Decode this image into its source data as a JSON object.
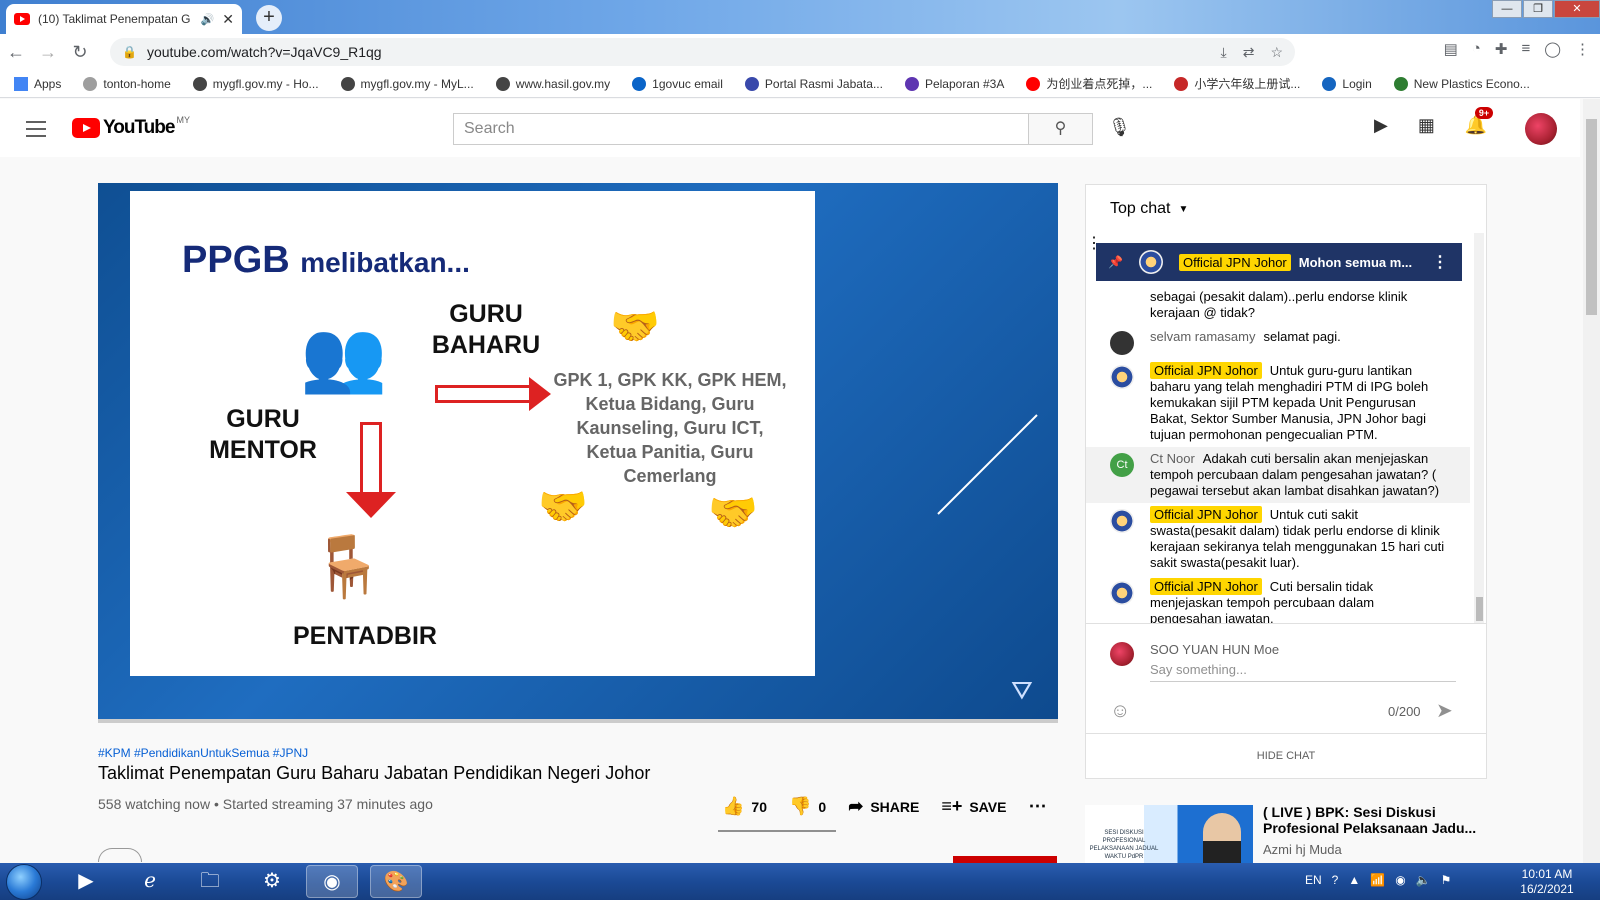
{
  "browser": {
    "tab_title": "(10) Taklimat Penempatan G",
    "url": "youtube.com/watch?v=JqaVC9_R1qg",
    "window_controls": {
      "minimize": "—",
      "maximize": "❐",
      "close": "✕"
    },
    "bookmarks": [
      {
        "label": "Apps",
        "color": "#4285f4"
      },
      {
        "label": "tonton-home",
        "color": "#9e9e9e"
      },
      {
        "label": "mygfl.gov.my - Ho...",
        "color": "#444444"
      },
      {
        "label": "mygfl.gov.my - MyL...",
        "color": "#444444"
      },
      {
        "label": "www.hasil.gov.my",
        "color": "#444444"
      },
      {
        "label": "1govuc email",
        "color": "#0a64c8"
      },
      {
        "label": "Portal Rasmi Jabata...",
        "color": "#3949ab"
      },
      {
        "label": "Pelaporan #3A",
        "color": "#5e35b1"
      },
      {
        "label": "为创业着点死掉，...",
        "color": "#ff0000"
      },
      {
        "label": "小学六年级上册试...",
        "color": "#c62828"
      },
      {
        "label": "Login",
        "color": "#1565c0"
      },
      {
        "label": "New Plastics Econo...",
        "color": "#2e7d32"
      }
    ]
  },
  "youtube": {
    "logo_text": "YouTube",
    "country": "MY",
    "search_placeholder": "Search",
    "notification_count": "9+"
  },
  "slide": {
    "title_main": "PPGB",
    "title_rest": "melibatkan...",
    "label_guru_baharu": "GURU BAHARU",
    "label_guru_mentor": "GURU MENTOR",
    "label_pentadbir": "PENTADBIR",
    "list_text": "GPK 1, GPK KK, GPK HEM, Ketua Bidang, Guru Kaunseling, Guru ICT, Ketua Panitia, Guru Cemerlang"
  },
  "video": {
    "hashtags": "#KPM #PendidikanUntukSemua #JPNJ",
    "title": "Taklimat Penempatan Guru Baharu Jabatan Pendidikan Negeri Johor",
    "stats": "558 watching now • Started streaming 37 minutes ago",
    "likes": "70",
    "dislikes": "0",
    "share_label": "SHARE",
    "save_label": "SAVE",
    "channel_name": "Official JPN Johor"
  },
  "chat": {
    "header": "Top chat",
    "pinned": {
      "author": "Official JPN Johor",
      "text": "Mohon semua m..."
    },
    "messages": [
      {
        "author": "",
        "text": "sebagai (pesakit dalam)..perlu endorse klinik kerajaan @ tidak?",
        "owner": false,
        "highlight": false,
        "avatar": "none"
      },
      {
        "author": "selvam ramasamy",
        "text": "selamat pagi.",
        "owner": false,
        "highlight": false,
        "avatar": "#333333"
      },
      {
        "author": "Official JPN Johor",
        "text": "Untuk guru-guru lantikan baharu yang telah menghadiri PTM di IPG boleh kemukakan sijil PTM kepada Unit Pengurusan Bakat, Sektor Sumber Manusia, JPN Johor bagi tujuan permohonan pengecualian PTM.",
        "owner": true,
        "highlight": false,
        "avatar": "crest"
      },
      {
        "author": "Ct Noor",
        "text": "Adakah cuti bersalin akan menjejaskan tempoh percubaan dalam pengesahan jawatan? ( pegawai tersebut akan lambat disahkan jawatan?)",
        "owner": false,
        "highlight": true,
        "avatar": "#43a047",
        "initials": "Ct"
      },
      {
        "author": "Official JPN Johor",
        "text": "Untuk cuti sakit swasta(pesakit dalam) tidak perlu endorse di klinik kerajaan sekiranya telah menggunakan 15 hari cuti sakit swasta(pesakit luar).",
        "owner": true,
        "highlight": false,
        "avatar": "crest"
      },
      {
        "author": "Official JPN Johor",
        "text": "Cuti bersalin tidak menjejaskan tempoh percubaan dalam pengesahan jawatan.",
        "owner": true,
        "highlight": false,
        "avatar": "crest"
      }
    ],
    "user_name": "SOO YUAN HUN Moe",
    "input_placeholder": "Say something...",
    "char_count": "0/200",
    "hide_chat": "HIDE CHAT"
  },
  "related": {
    "title": "( LIVE ) BPK: Sesi Diskusi Profesional Pelaksanaan Jadu...",
    "channel": "Azmi hj Muda",
    "thumb_text": "SESI DISKUSI PROFESIONAL PELAKSANAAN JADUAL WAKTU PdPR"
  },
  "taskbar": {
    "lang": "EN",
    "time": "10:01 AM",
    "date": "16/2/2021"
  }
}
